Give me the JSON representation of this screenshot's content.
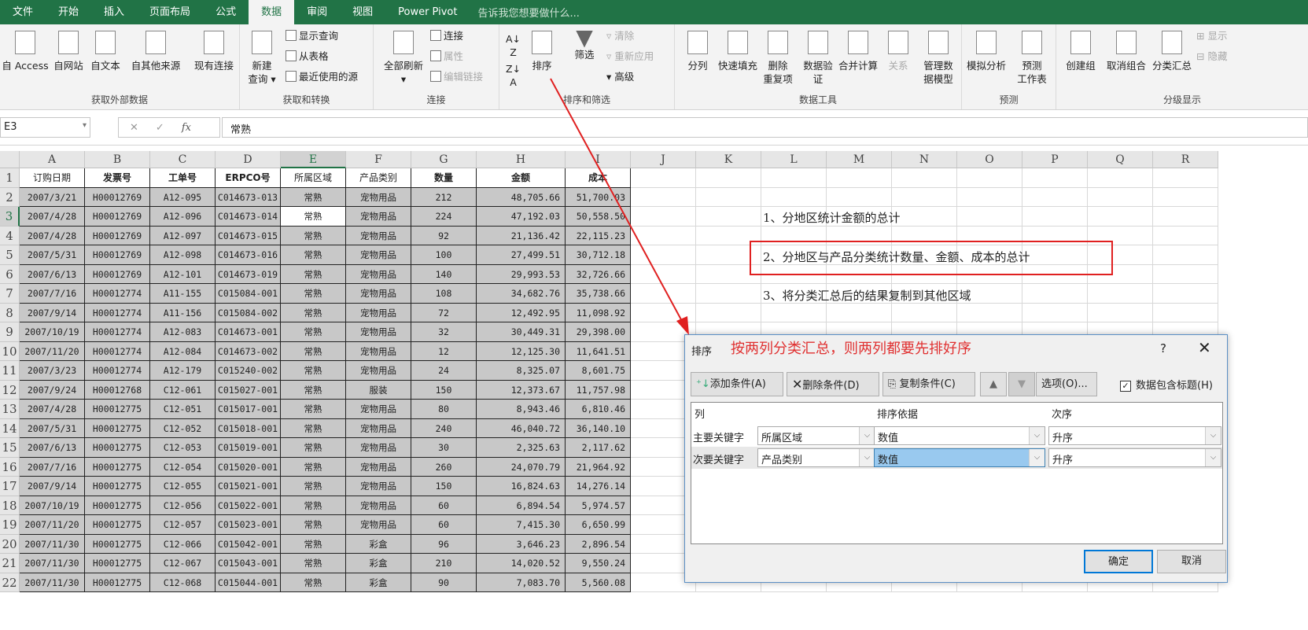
{
  "tabs": [
    "文件",
    "开始",
    "插入",
    "页面布局",
    "公式",
    "数据",
    "审阅",
    "视图",
    "Power Pivot"
  ],
  "active_tab": "数据",
  "tell_me": "告诉我您想要做什么...",
  "ribbon": {
    "groups": [
      "获取外部数据",
      "获取和转换",
      "连接",
      "排序和筛选",
      "数据工具",
      "预测",
      "分级显示"
    ],
    "ext": [
      "自 Access",
      "自网站",
      "自文本",
      "自其他来源",
      "现有连接"
    ],
    "get": {
      "new_query": "新建",
      "new_query2": "查询",
      "show": "显示查询",
      "from_table": "从表格",
      "recent": "最近使用的源"
    },
    "conn": {
      "refresh": "全部刷新",
      "connections": "连接",
      "properties": "属性",
      "edit_links": "编辑链接"
    },
    "sort": {
      "sort": "排序",
      "filter": "筛选",
      "clear": "清除",
      "reapply": "重新应用",
      "advanced": "高级"
    },
    "tools": [
      [
        "分列",
        ""
      ],
      [
        "快速填充",
        ""
      ],
      [
        "删除",
        "重复项"
      ],
      [
        "数据验",
        "证"
      ],
      [
        "合并计算",
        ""
      ],
      [
        "关系",
        ""
      ],
      [
        "管理数",
        "据模型"
      ]
    ],
    "forecast": [
      [
        "模拟分析",
        ""
      ],
      [
        "预测",
        "工作表"
      ]
    ],
    "outline": [
      "创建组",
      "取消组合",
      "分类汇总",
      "显示",
      "隐藏"
    ]
  },
  "formula_bar": {
    "name_box": "E3",
    "value": "常熟",
    "fx": "fx"
  },
  "columns": [
    "A",
    "B",
    "C",
    "D",
    "E",
    "F",
    "G",
    "H",
    "I",
    "J",
    "K",
    "L",
    "M",
    "N",
    "O",
    "P",
    "Q",
    "R"
  ],
  "headers": [
    "订购日期",
    "发票号",
    "工单号",
    "ERPCO号",
    "所属区域",
    "产品类别",
    "数量",
    "金额",
    "成本"
  ],
  "rows": [
    [
      "2007/3/21",
      "H00012769",
      "A12-095",
      "C014673-013",
      "常熟",
      "宠物用品",
      "212",
      "48,705.66",
      "51,700.03"
    ],
    [
      "2007/4/28",
      "H00012769",
      "A12-096",
      "C014673-014",
      "常熟",
      "宠物用品",
      "224",
      "47,192.03",
      "50,558.50"
    ],
    [
      "2007/4/28",
      "H00012769",
      "A12-097",
      "C014673-015",
      "常熟",
      "宠物用品",
      "92",
      "21,136.42",
      "22,115.23"
    ],
    [
      "2007/5/31",
      "H00012769",
      "A12-098",
      "C014673-016",
      "常熟",
      "宠物用品",
      "100",
      "27,499.51",
      "30,712.18"
    ],
    [
      "2007/6/13",
      "H00012769",
      "A12-101",
      "C014673-019",
      "常熟",
      "宠物用品",
      "140",
      "29,993.53",
      "32,726.66"
    ],
    [
      "2007/7/16",
      "H00012774",
      "A11-155",
      "C015084-001",
      "常熟",
      "宠物用品",
      "108",
      "34,682.76",
      "35,738.66"
    ],
    [
      "2007/9/14",
      "H00012774",
      "A11-156",
      "C015084-002",
      "常熟",
      "宠物用品",
      "72",
      "12,492.95",
      "11,098.92"
    ],
    [
      "2007/10/19",
      "H00012774",
      "A12-083",
      "C014673-001",
      "常熟",
      "宠物用品",
      "32",
      "30,449.31",
      "29,398.00"
    ],
    [
      "2007/11/20",
      "H00012774",
      "A12-084",
      "C014673-002",
      "常熟",
      "宠物用品",
      "12",
      "12,125.30",
      "11,641.51"
    ],
    [
      "2007/3/23",
      "H00012774",
      "A12-179",
      "C015240-002",
      "常熟",
      "宠物用品",
      "24",
      "8,325.07",
      "8,601.75"
    ],
    [
      "2007/9/24",
      "H00012768",
      "C12-061",
      "C015027-001",
      "常熟",
      "服装",
      "150",
      "12,373.67",
      "11,757.98"
    ],
    [
      "2007/4/28",
      "H00012775",
      "C12-051",
      "C015017-001",
      "常熟",
      "宠物用品",
      "80",
      "8,943.46",
      "6,810.46"
    ],
    [
      "2007/5/31",
      "H00012775",
      "C12-052",
      "C015018-001",
      "常熟",
      "宠物用品",
      "240",
      "46,040.72",
      "36,140.10"
    ],
    [
      "2007/6/13",
      "H00012775",
      "C12-053",
      "C015019-001",
      "常熟",
      "宠物用品",
      "30",
      "2,325.63",
      "2,117.62"
    ],
    [
      "2007/7/16",
      "H00012775",
      "C12-054",
      "C015020-001",
      "常熟",
      "宠物用品",
      "260",
      "24,070.79",
      "21,964.92"
    ],
    [
      "2007/9/14",
      "H00012775",
      "C12-055",
      "C015021-001",
      "常熟",
      "宠物用品",
      "150",
      "16,824.63",
      "14,276.14"
    ],
    [
      "2007/10/19",
      "H00012775",
      "C12-056",
      "C015022-001",
      "常熟",
      "宠物用品",
      "60",
      "6,894.54",
      "5,974.57"
    ],
    [
      "2007/11/20",
      "H00012775",
      "C12-057",
      "C015023-001",
      "常熟",
      "宠物用品",
      "60",
      "7,415.30",
      "6,650.99"
    ],
    [
      "2007/11/30",
      "H00012775",
      "C12-066",
      "C015042-001",
      "常熟",
      "彩盒",
      "96",
      "3,646.23",
      "2,896.54"
    ],
    [
      "2007/11/30",
      "H00012775",
      "C12-067",
      "C015043-001",
      "常熟",
      "彩盒",
      "210",
      "14,020.52",
      "9,550.24"
    ],
    [
      "2007/11/30",
      "H00012775",
      "C12-068",
      "C015044-001",
      "常熟",
      "彩盒",
      "90",
      "7,083.70",
      "5,560.08"
    ]
  ],
  "notes": [
    "1、分地区统计金额的总计",
    "2、分地区与产品分类统计数量、金额、成本的总计",
    "3、将分类汇总后的结果复制到其他区域"
  ],
  "dialog": {
    "title": "排序",
    "annotation": "按两列分类汇总，则两列都要先排好序",
    "help": "?",
    "close": "✕",
    "add": "添加条件(A)",
    "delete": "删除条件(D)",
    "copy": "复制条件(C)",
    "options": "选项(O)...",
    "has_header": "数据包含标题(H)",
    "has_header_checked": true,
    "col_headers": [
      "列",
      "排序依据",
      "次序"
    ],
    "levels": [
      {
        "label": "主要关键字",
        "column": "所属区域",
        "sort_on": "数值",
        "order": "升序"
      },
      {
        "label": "次要关键字",
        "column": "产品类别",
        "sort_on": "数值",
        "order": "升序"
      }
    ],
    "ok": "确定",
    "cancel": "取消"
  },
  "colors": {
    "excel_green": "#217346",
    "annotation_red": "#e02020"
  }
}
